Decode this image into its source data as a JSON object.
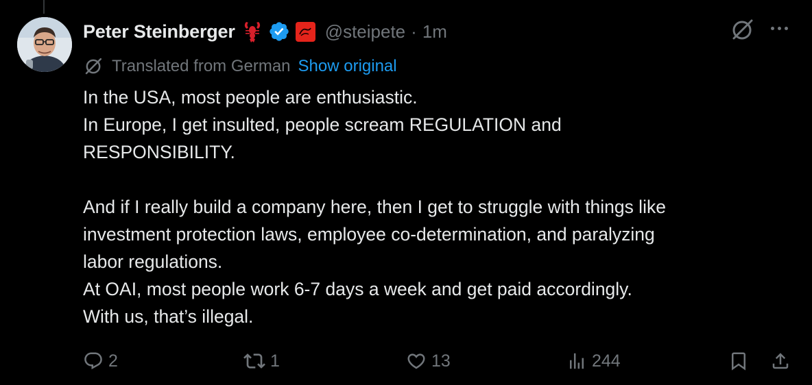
{
  "post": {
    "author": {
      "display_name": "Peter Steinberger",
      "handle": "@steipete",
      "separator": "·",
      "time": "1m",
      "name_emoji": "lobster-icon",
      "verified": true,
      "affiliation_badge": "red-badge-icon"
    },
    "translation": {
      "label": "Translated from German",
      "show_original": "Show original"
    },
    "text_lines": [
      "In the USA, most people are enthusiastic.",
      "In Europe, I get insulted, people scream REGULATION and",
      "RESPONSIBILITY.",
      "",
      "And if I really build a company here, then I get to struggle with things like",
      "investment protection laws, employee co-determination, and paralyzing",
      "labor regulations.",
      "At OAI, most people work 6-7 days a week and get paid accordingly.",
      "With us, that’s illegal."
    ],
    "actions": {
      "replies": "2",
      "reposts": "1",
      "likes": "13",
      "views": "244"
    }
  },
  "colors": {
    "background": "#000000",
    "text": "#e7e9ea",
    "muted": "#71767b",
    "link": "#1d9bf0",
    "verified": "#1d9bf0",
    "affiliation_badge": "#e5241b"
  }
}
